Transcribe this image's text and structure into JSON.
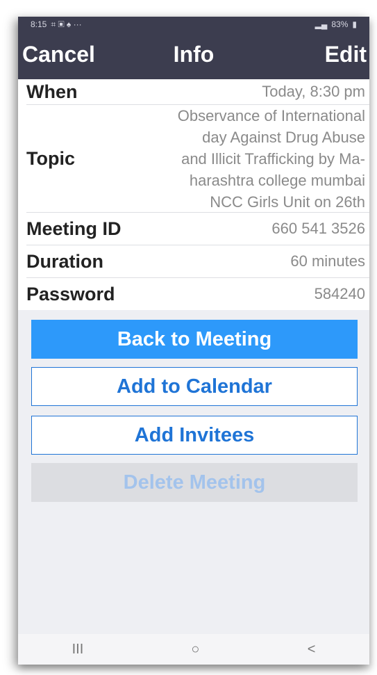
{
  "status_bar": {
    "time": "8:15",
    "left_icons": "⌗ ▣ ♠ ···",
    "right_text": "83%"
  },
  "nav": {
    "cancel_label": "Cancel",
    "title": "Info",
    "edit_label": "Edit"
  },
  "info": {
    "when": {
      "label": "When",
      "value": "Today, 8:30 pm"
    },
    "topic": {
      "label": "Topic",
      "lines": [
        "Observance of International",
        "day Against Drug Abuse",
        "and Illicit Trafficking by Ma-",
        "harashtra college mumbai",
        "NCC Girls Unit on 26th"
      ]
    },
    "meeting_id": {
      "label": "Meeting ID",
      "value": "660 541 3526"
    },
    "duration": {
      "label": "Duration",
      "value": "60 minutes"
    },
    "password": {
      "label": "Password",
      "value": "584240"
    }
  },
  "actions": {
    "back_label": "Back to Meeting",
    "calendar_label": "Add to Calendar",
    "invitees_label": "Add Invitees",
    "delete_label": "Delete Meeting"
  },
  "nav_keys": {
    "recent": "III",
    "home": "○",
    "back": "<"
  },
  "colors": {
    "header_bg": "#3c3d4f",
    "primary_blue": "#2d99fa",
    "outline_blue": "#1f74d6",
    "disabled_text": "#a3c3ec"
  }
}
